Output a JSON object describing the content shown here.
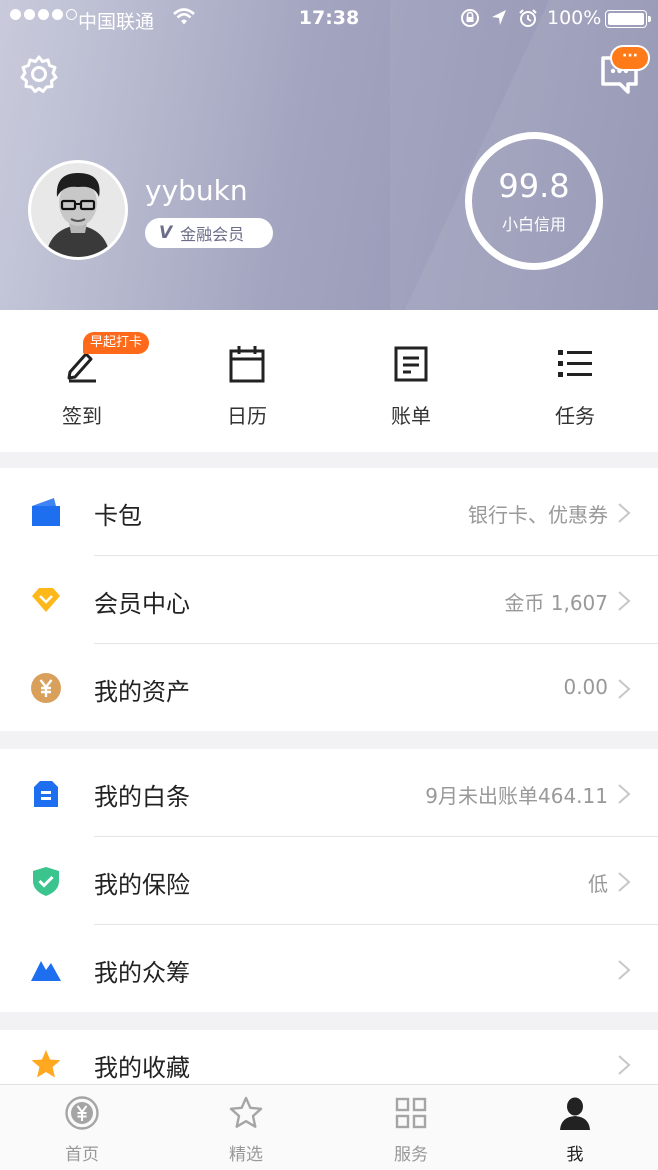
{
  "status_bar": {
    "carrier": "中国联通",
    "time": "17:38",
    "battery": "100%"
  },
  "header": {
    "username": "yybukn",
    "member_label": "金融会员",
    "member_v": "V",
    "credit_score": "99.8",
    "credit_label": "小白信用",
    "msg_badge": "···"
  },
  "quick_actions": {
    "badge": "早起打卡",
    "items": [
      {
        "label": "签到",
        "icon": "pen-icon"
      },
      {
        "label": "日历",
        "icon": "calendar-icon"
      },
      {
        "label": "账单",
        "icon": "bill-icon"
      },
      {
        "label": "任务",
        "icon": "task-list-icon"
      }
    ]
  },
  "sections": [
    {
      "rows": [
        {
          "title": "卡包",
          "value": "银行卡、优惠券",
          "icon": "wallet-icon",
          "color": "#1e6ff0"
        },
        {
          "title": "会员中心",
          "value": "金币 1,607",
          "icon": "diamond-icon",
          "color": "#ffb81a"
        },
        {
          "title": "我的资产",
          "value": "0.00",
          "icon": "yuan-coin-icon",
          "color": "#d9a05b"
        }
      ]
    },
    {
      "rows": [
        {
          "title": "我的白条",
          "value": "9月未出账单464.11",
          "icon": "iou-icon",
          "color": "#1e6ff0"
        },
        {
          "title": "我的保险",
          "value": "低",
          "icon": "shield-check-icon",
          "color": "#3cc48f"
        },
        {
          "title": "我的众筹",
          "value": "",
          "icon": "mountain-icon",
          "color": "#1e6ff0"
        }
      ]
    },
    {
      "rows": [
        {
          "title": "我的收藏",
          "value": "",
          "icon": "star-icon",
          "color": "#ffa820"
        }
      ]
    }
  ],
  "tabbar": {
    "tabs": [
      {
        "label": "首页",
        "icon": "yuan-circle-icon",
        "active": false
      },
      {
        "label": "精选",
        "icon": "star-outline-icon",
        "active": false
      },
      {
        "label": "服务",
        "icon": "grid-icon",
        "active": false
      },
      {
        "label": "我",
        "icon": "person-icon",
        "active": true
      }
    ]
  }
}
